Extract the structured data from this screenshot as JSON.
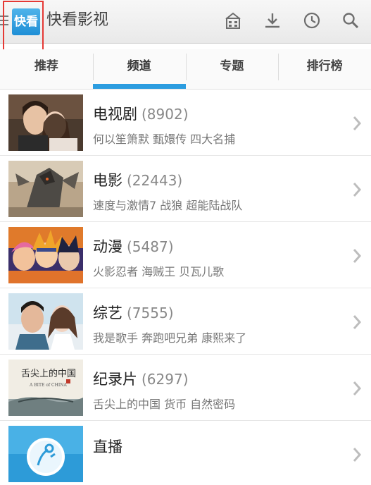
{
  "app": {
    "logo_text": "快看",
    "title": "快看影视"
  },
  "toolbar_icons": [
    "store-icon",
    "download-icon",
    "history-icon",
    "search-icon"
  ],
  "tabs": [
    {
      "label": "推荐",
      "active": false
    },
    {
      "label": "频道",
      "active": true
    },
    {
      "label": "专题",
      "active": false
    },
    {
      "label": "排行榜",
      "active": false
    }
  ],
  "channels": [
    {
      "name": "电视剧",
      "count": "(8902)",
      "subtitle": "何以笙箫默 甄嬛传 四大名捕"
    },
    {
      "name": "电影",
      "count": "(22443)",
      "subtitle": "速度与激情7 战狼 超能陆战队"
    },
    {
      "name": "动漫",
      "count": "(5487)",
      "subtitle": "火影忍者 海贼王 贝瓦儿歌"
    },
    {
      "name": "综艺",
      "count": "(7555)",
      "subtitle": "我是歌手 奔跑吧兄弟 康熙来了"
    },
    {
      "name": "纪录片",
      "count": "(6297)",
      "subtitle": "舌尖上的中国 货币 自然密码"
    },
    {
      "name": "直播",
      "count": "",
      "subtitle": ""
    }
  ],
  "thumb_texts": {
    "documentary_title": "舌尖上的中国",
    "documentary_en": "A BITE of CHINA"
  },
  "colors": {
    "accent": "#2c9de0",
    "logo": "#1f8fd6",
    "highlight": "#e53935"
  }
}
